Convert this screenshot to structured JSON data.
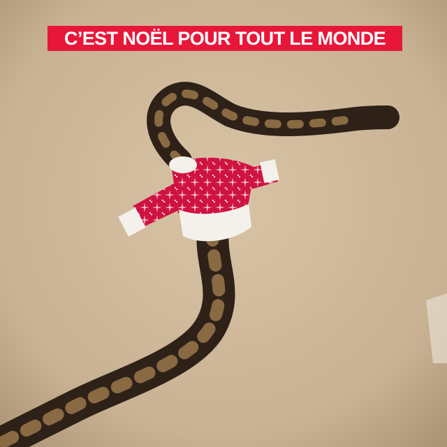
{
  "caption": {
    "text": "C’EST NOËL POUR TOUT LE MONDE",
    "background_color": "#e8173a",
    "text_color": "#ffffff"
  },
  "scene": {
    "carpet_color": "#cdb697",
    "snake_dark_color": "#2e2118",
    "snake_pattern_color": "#8a6a43",
    "sweater_red": "#cf1340",
    "sweater_white": "#f4f1ec"
  }
}
